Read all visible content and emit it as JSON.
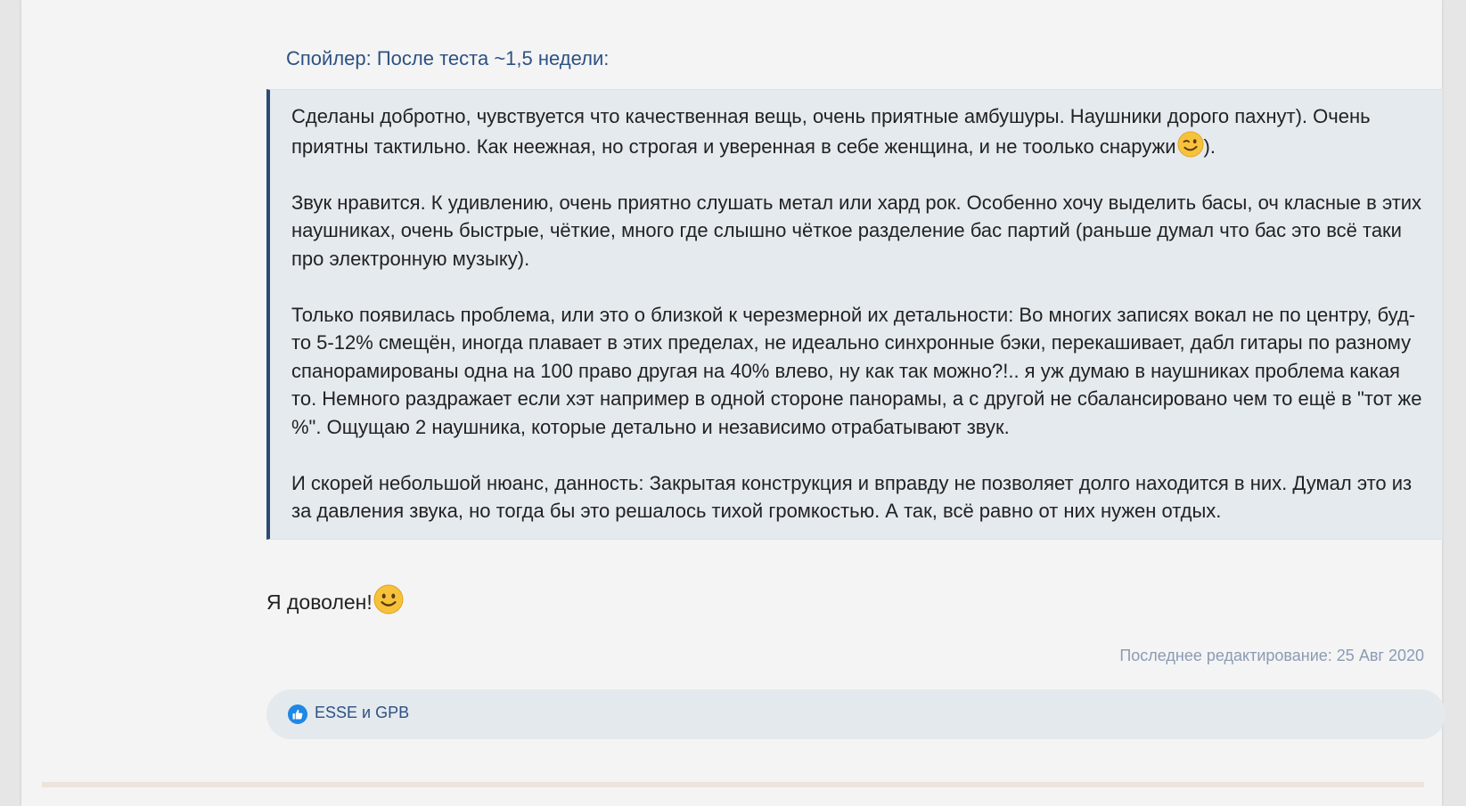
{
  "spoiler": {
    "title": "Спойлер: После теста ~1,5 недели:",
    "paragraphs": [
      {
        "text": "Сделаны добротно, чувствуется что качественная вещь, очень приятные амбушуры. Наушники дорого пахнут). Очень приятны тактильно. Как неежная, но строгая и уверенная в себе женщина, и не тоолько снаружи",
        "after_emoji": ")."
      },
      {
        "text": "Звук нравится. К удивлению, очень приятно слушать метал или хард рок. Особенно хочу выделить басы, оч класные в этих наушниках, очень быстрые, чёткие, много где слышно чёткое разделение бас партий (раньше думал что бас это всё таки про электронную музыку)."
      },
      {
        "text": "Только появилась проблема, или это о близкой к черезмерной их детальности: Во многих записях вокал не по центру, буд-то 5-12% смещён, иногда плавает в этих пределах, не идеально синхронные бэки, перекашивает, дабл гитары по разному спанорамированы одна на 100 право другая на 40% влево, ну как так можно?!.. я уж думаю в наушниках проблема какая то. Немного раздражает если хэт например в одной стороне панорамы, а с другой не сбалансировано чем то ещё в \"тот же %\". Ощущаю 2 наушника, которые детально и независимо отрабатывают звук."
      },
      {
        "text": "И скорей небольшой нюанс, данность: Закрытая конструкция и вправду не позволяет долго находится в них. Думал это из за давления звука, но тогда бы это решалось тихой громкостью. А так, всё равно от них нужен отдых."
      }
    ]
  },
  "closing": {
    "text": "Я доволен!"
  },
  "edited": {
    "text": "Последнее редактирование: 25 Авг 2020"
  },
  "reactions": {
    "text": "ESSE и GPB"
  },
  "icons": {
    "wink": "wink-emoji-icon",
    "smile": "smile-emoji-icon",
    "like": "thumbs-up-icon"
  },
  "colors": {
    "link": "#2c5183",
    "spoiler_border": "#2e4a73",
    "spoiler_bg": "#e5eaef",
    "edited_text": "#8a9bb5",
    "like_icon": "#1e88e5"
  }
}
